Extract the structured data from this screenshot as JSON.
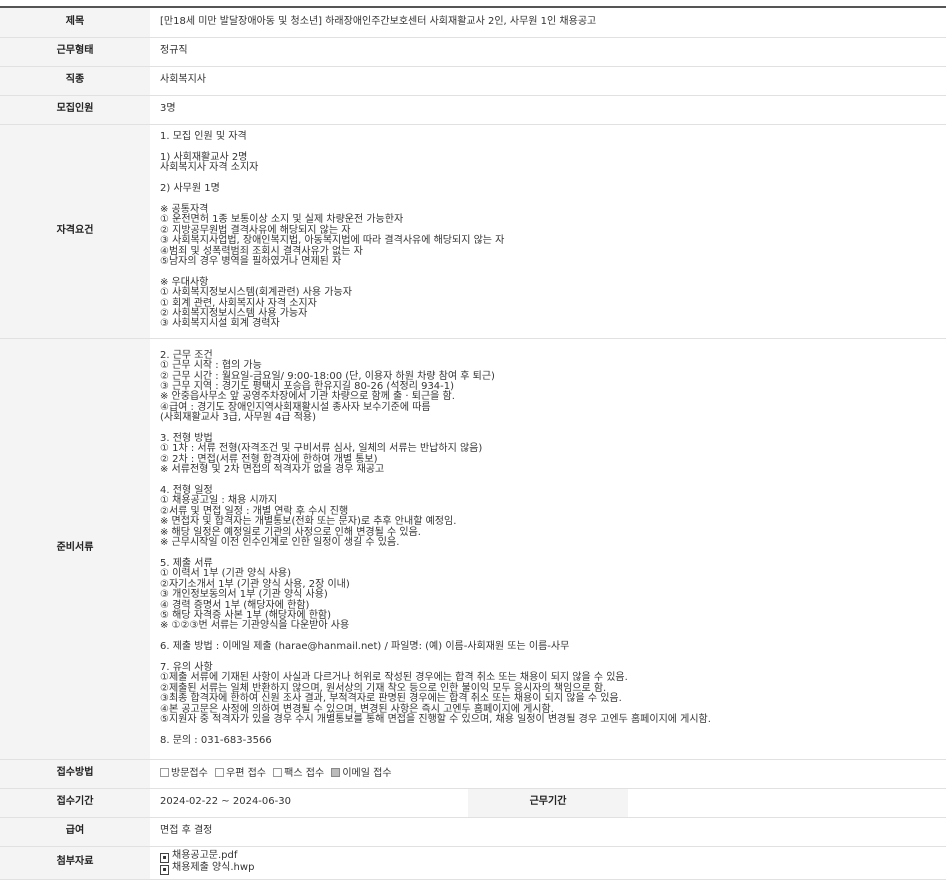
{
  "rows": {
    "title": {
      "label": "제목",
      "value": "[만18세 미만 발달장애아동 및 청소년] 하래장애인주간보호센터 사회재활교사 2인, 사무원 1인 채용공고"
    },
    "work_type": {
      "label": "근무형태",
      "value": "정규직"
    },
    "job": {
      "label": "직종",
      "value": "사회복지사"
    },
    "headcount": {
      "label": "모집인원",
      "value": "3명"
    },
    "requirements": {
      "label": "자격요건",
      "value": "1. 모집 인원 및 자격\n\n1) 사회재활교사 2명\n사회복지사 자격 소지자\n\n2) 사무원 1명\n\n※ 공통자격\n① 운전면허 1종 보통이상 소지 및 실제 차량운전 가능한자\n② 지방공무원법 결격사유에 해당되지 않는 자\n③ 사회복지사업법, 장애인복지법, 아동복지법에 따라 결격사유에 해당되지 않는 자\n④범죄 및 성폭력범죄 조회시 결격사유가 없는 자\n⑤남자의 경우 병역을 필하였거나 면제된 자\n\n※ 우대사항\n① 사회복지정보시스템(회계관련) 사용 가능자\n① 회계 관련, 사회복지사 자격 소지자\n② 사회복지정보시스템 사용 가능자\n③ 사회복지시설 회계 경력자"
    },
    "documents": {
      "label": "준비서류",
      "value": "2. 근무 조건\n① 근무 시작 : 협의 가능\n② 근무 시간 : 월요일-금요일/ 9:00-18:00 (단, 이용자 하원 차량 참여 후 퇴근)\n③ 근무 지역 : 경기도 평택시 포승읍 한유지길 80-26 (석정리 934-1)\n※ 안중읍사무소 앞 공영주차장에서 기관 차량으로 함께 출 · 퇴근을 함.\n④급여 : 경기도 장애인지역사회재활시설 종사자 보수기준에 따름\n(사회재활교사 3급, 사무원 4급 적용)\n\n3. 전형 방법\n① 1차 : 서류 전형(자격조건 및 구비서류 심사, 일체의 서류는 반납하지 않음)\n② 2차 : 면접(서류 전형 합격자에 한하여 개별 통보)\n※ 서류전형 및 2차 면접의 적격자가 없을 경우 재공고\n\n4. 전형 일정\n① 채용공고일 : 채용 시까지\n②서류 및 면접 일정 : 개별 연락 후 수시 진행\n※ 면접자 및 합격자는 개별통보(전화 또는 문자)로 추후 안내할 예정임.\n※ 해당 일정은 예정일로 기관의 사정으로 인해 변경될 수 있음.\n※ 근무시작일 이전 인수인계로 인한 일정이 생길 수 있음.\n\n5. 제출 서류\n① 이력서 1부 (기관 양식 사용)\n②자기소개서 1부 (기관 양식 사용, 2장 이내)\n③ 개인정보동의서 1부 (기관 양식 사용)\n④ 경력 증명서 1부 (해당자에 한함)\n⑤ 해당 자격증 사본 1부 (해당자에 한함)\n※ ①②③번 서류는 기관양식을 다운받아 사용\n\n6. 제출 방법 : 이메일 제출 (harae@hanmail.net) / 파일명: (예) 이름-사회재원 또는 이름-사무\n\n7. 유의 사항\n①제출 서류에 기재된 사항이 사실과 다르거나 허위로 작성된 경우에는 합격 취소 또는 채용이 되지 않을 수 있음.\n②제출된 서류는 일체 반환하지 않으며, 원서상의 기재 착오 등으로 인한 불이익 모두 응시자의 책임으로 함.\n③최종 합격자에 한하여 신원 조사 결과, 부적격자로 판명된 경우에는 합격 취소 또는 채용이 되지 않을 수 있음.\n④본 공고문은 사정에 의하여 변경될 수 있으며, 변경된 사항은 즉시 고엔두 홈페이지에 게시함.\n⑤지원자 중 적격자가 있을 경우 수시 개별통보를 통해 면접을 진행할 수 있으며, 채용 일정이 변경될 경우 고엔두 홈페이지에 게시함.\n\n8. 문의 : 031-683-3566"
    },
    "apply_method": {
      "label": "접수방법",
      "options": [
        {
          "text": "방문접수",
          "checked": false
        },
        {
          "text": "우편 접수",
          "checked": false
        },
        {
          "text": "팩스 접수",
          "checked": false
        },
        {
          "text": "이메일 접수",
          "checked": true
        }
      ]
    },
    "apply_period": {
      "label": "접수기간",
      "value": "2024-02-22 ~ 2024-06-30",
      "sub_label": "근무기간",
      "sub_value": ""
    },
    "salary": {
      "label": "급여",
      "value": "면접 후 결정"
    },
    "attachments": {
      "label": "첨부자료",
      "files": [
        "채용공고문.pdf",
        "채용제출 양식.hwp"
      ]
    }
  }
}
